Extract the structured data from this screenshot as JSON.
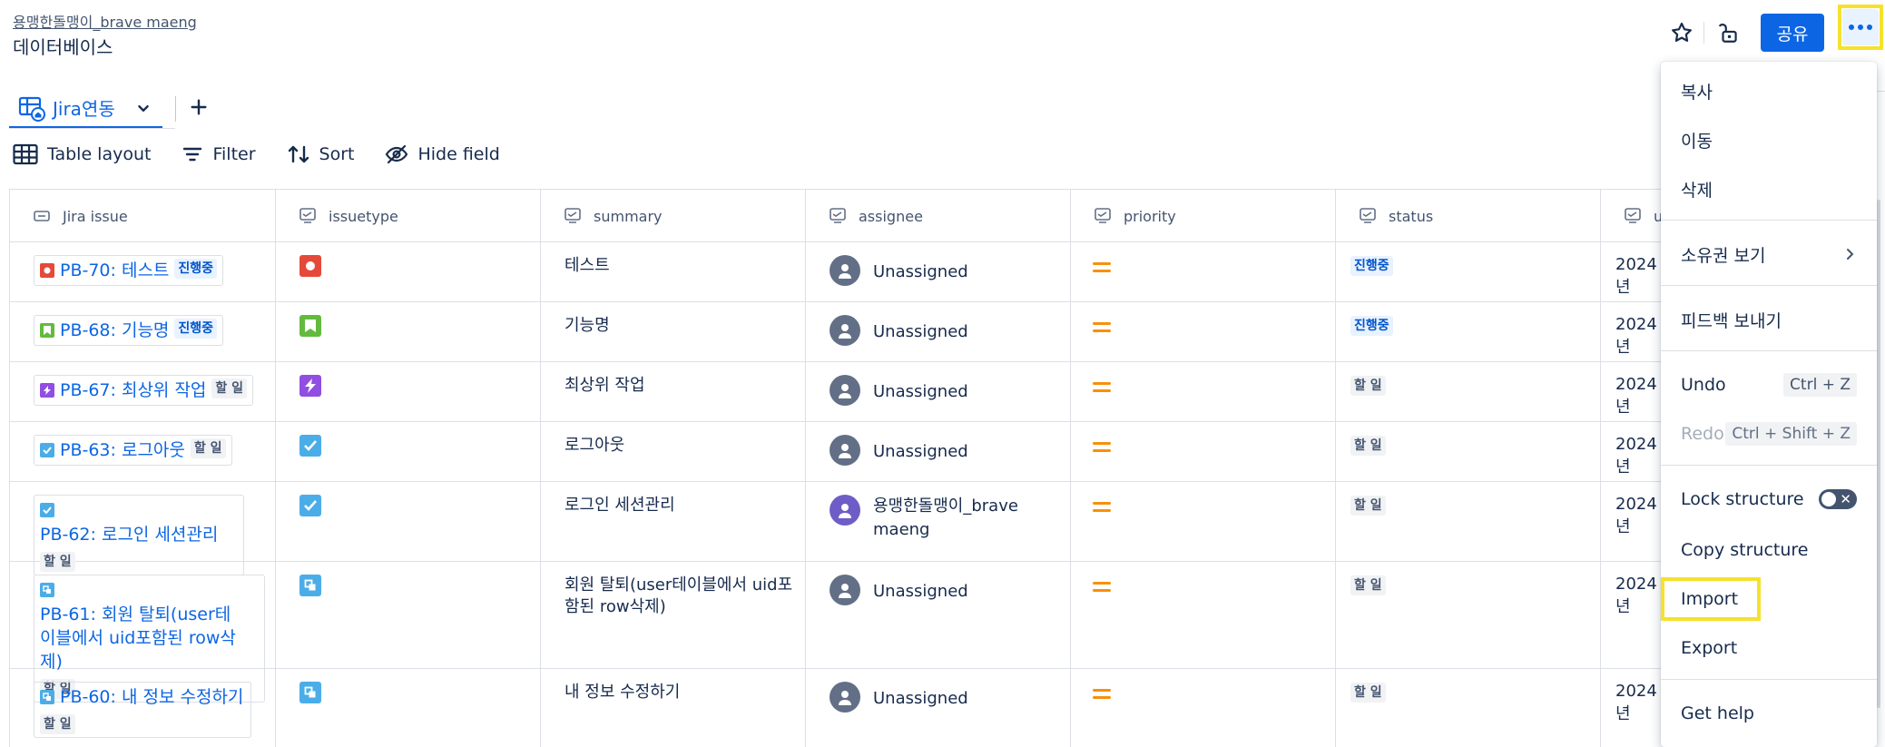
{
  "breadcrumb": "용맹한돌맹이_brave maeng",
  "page_title": "데이터베이스",
  "header": {
    "share_label": "공유"
  },
  "view_tab": {
    "label": "Jira연동"
  },
  "toolbar": {
    "table_layout": "Table layout",
    "filter": "Filter",
    "sort": "Sort",
    "hide_field": "Hide field"
  },
  "columns": [
    "Jira issue",
    "issuetype",
    "summary",
    "assignee",
    "priority",
    "status",
    "upd"
  ],
  "rows": [
    {
      "key": "PB-70: 테스트",
      "key_status": "진행중",
      "type": "bug",
      "summary": "테스트",
      "assignee": "Unassigned",
      "status": "진행중",
      "updated": "2024년"
    },
    {
      "key": "PB-68: 기능명",
      "key_status": "진행중",
      "type": "story",
      "summary": "기능명",
      "assignee": "Unassigned",
      "status": "진행중",
      "updated": "2024년"
    },
    {
      "key": "PB-67: 최상위 작업",
      "key_status": "할 일",
      "type": "epic",
      "summary": "최상위 작업",
      "assignee": "Unassigned",
      "status": "할 일",
      "updated": "2024년"
    },
    {
      "key": "PB-63: 로그아웃",
      "key_status": "할 일",
      "type": "task",
      "summary": "로그아웃",
      "assignee": "Unassigned",
      "status": "할 일",
      "updated": "2024년"
    },
    {
      "key": "PB-62: 로그인 세션관리",
      "key_status": "할 일",
      "type": "task",
      "summary": "로그인 세션관리",
      "assignee": "용맹한돌맹이_brave maeng",
      "status": "할 일",
      "updated": "2024년"
    },
    {
      "key": "PB-61: 회원 탈퇴(user테이블에서 uid포함된 row삭제)",
      "key_status": "할 일",
      "type": "subtask",
      "summary": "회원 탈퇴(user테이블에서 uid포함된 row삭제)",
      "assignee": "Unassigned",
      "status": "할 일",
      "updated": "2024년"
    },
    {
      "key": "PB-60: 내 정보 수정하기",
      "key_status": "할 일",
      "type": "subtask",
      "summary": "내 정보 수정하기",
      "assignee": "Unassigned",
      "status": "할 일",
      "updated": "2024년"
    }
  ],
  "menu": {
    "copy": "복사",
    "move": "이동",
    "delete": "삭제",
    "view_ownership": "소유권 보기",
    "send_feedback": "피드백 보내기",
    "undo": "Undo",
    "undo_shortcut": "Ctrl + Z",
    "redo": "Redo",
    "redo_shortcut": "Ctrl + Shift + Z",
    "lock_structure": "Lock structure",
    "copy_structure": "Copy structure",
    "import": "Import",
    "export": "Export",
    "get_help": "Get help"
  },
  "colors": {
    "primary": "#0c66e4",
    "highlight": "#f6e12c",
    "priority_medium": "#f79009",
    "bug": "#e5493a",
    "story": "#63ba3c",
    "epic": "#904ee2",
    "task": "#4bade8"
  }
}
